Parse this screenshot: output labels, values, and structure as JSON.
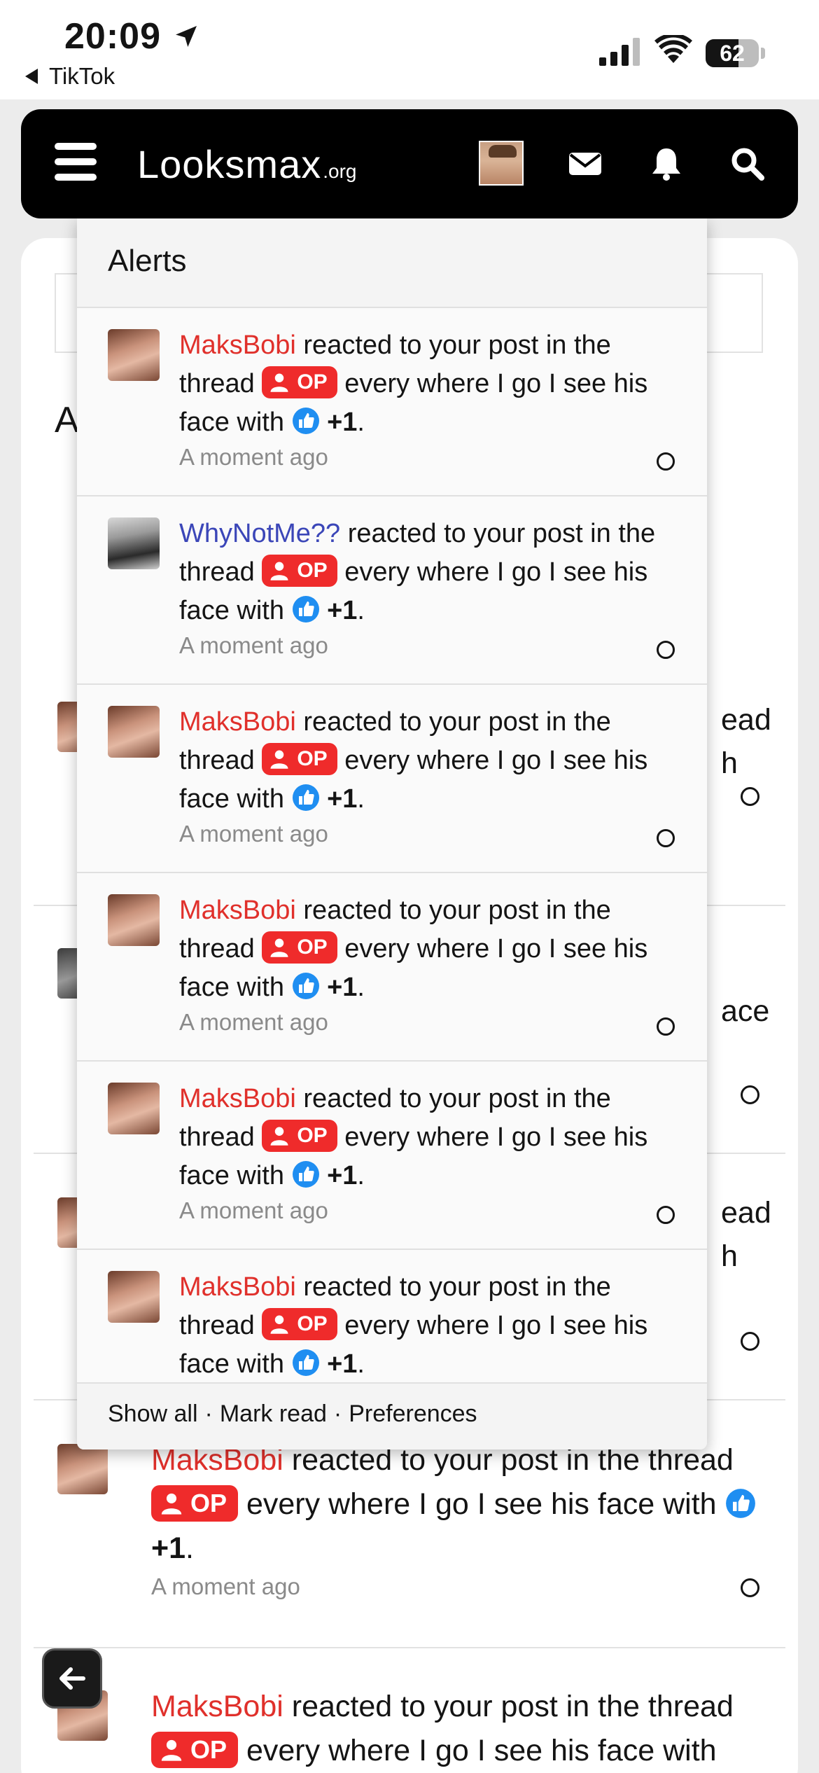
{
  "status_bar": {
    "time": "20:09",
    "back_app": "TikTok",
    "battery": "62",
    "battery_level": 0.62
  },
  "header": {
    "logo_main": "Looksmax",
    "logo_tld": ".org",
    "icons": [
      "menu-icon",
      "avatar",
      "mail-icon",
      "bell-icon",
      "search-icon"
    ]
  },
  "background": {
    "heading_fragment": "A",
    "fragments": [
      "ead",
      "h",
      "ace",
      "ead",
      "h"
    ],
    "alerts": [
      {
        "user": "MaksBobi",
        "text_before": "reacted to your post in the thread",
        "badge": "OP",
        "text_after": "every where I go I see his face with",
        "reaction": "+1",
        "period": ".",
        "time": "A moment ago"
      },
      {
        "user": "MaksBobi",
        "text_before": "reacted to your post in the thread",
        "badge": "OP",
        "text_after": "every where I go I see his face with"
      }
    ]
  },
  "alerts_panel": {
    "title": "Alerts",
    "items": [
      {
        "user": "MaksBobi",
        "user_color": "#e0302b",
        "text_before": "reacted to your post in the thread",
        "badge": "OP",
        "text_after": "every where I go I see his face with",
        "reaction": "+1",
        "period": ".",
        "time": "A moment ago"
      },
      {
        "user": "WhyNotMe??",
        "user_color": "#3b46b8",
        "text_before": "reacted to your post in the thread",
        "badge": "OP",
        "text_after": "every where I go I see his face with",
        "reaction": "+1",
        "period": ".",
        "time": "A moment ago"
      },
      {
        "user": "MaksBobi",
        "user_color": "#e0302b",
        "text_before": "reacted to your post in the thread",
        "badge": "OP",
        "text_after": "every where I go I see his face with",
        "reaction": "+1",
        "period": ".",
        "time": "A moment ago"
      },
      {
        "user": "MaksBobi",
        "user_color": "#e0302b",
        "text_before": "reacted to your post in the thread",
        "badge": "OP",
        "text_after": "every where I go I see his face with",
        "reaction": "+1",
        "period": ".",
        "time": "A moment ago"
      },
      {
        "user": "MaksBobi",
        "user_color": "#e0302b",
        "text_before": "reacted to your post in the thread",
        "badge": "OP",
        "text_after": "every where I go I see his face with",
        "reaction": "+1",
        "period": ".",
        "time": "A moment ago"
      },
      {
        "user": "MaksBobi",
        "user_color": "#e0302b",
        "text_before": "reacted to your post in the thread",
        "badge": "OP",
        "text_after": "every where I go I see his face with",
        "reaction": "+1",
        "period": "."
      }
    ],
    "footer": {
      "show_all": "Show all",
      "mark_read": "Mark read",
      "preferences": "Preferences",
      "separator": "·"
    }
  },
  "colors": {
    "badge_red": "#ef2b2b",
    "user_red": "#e0302b",
    "user_blue": "#3b46b8",
    "like_blue": "#1f8ef1"
  }
}
